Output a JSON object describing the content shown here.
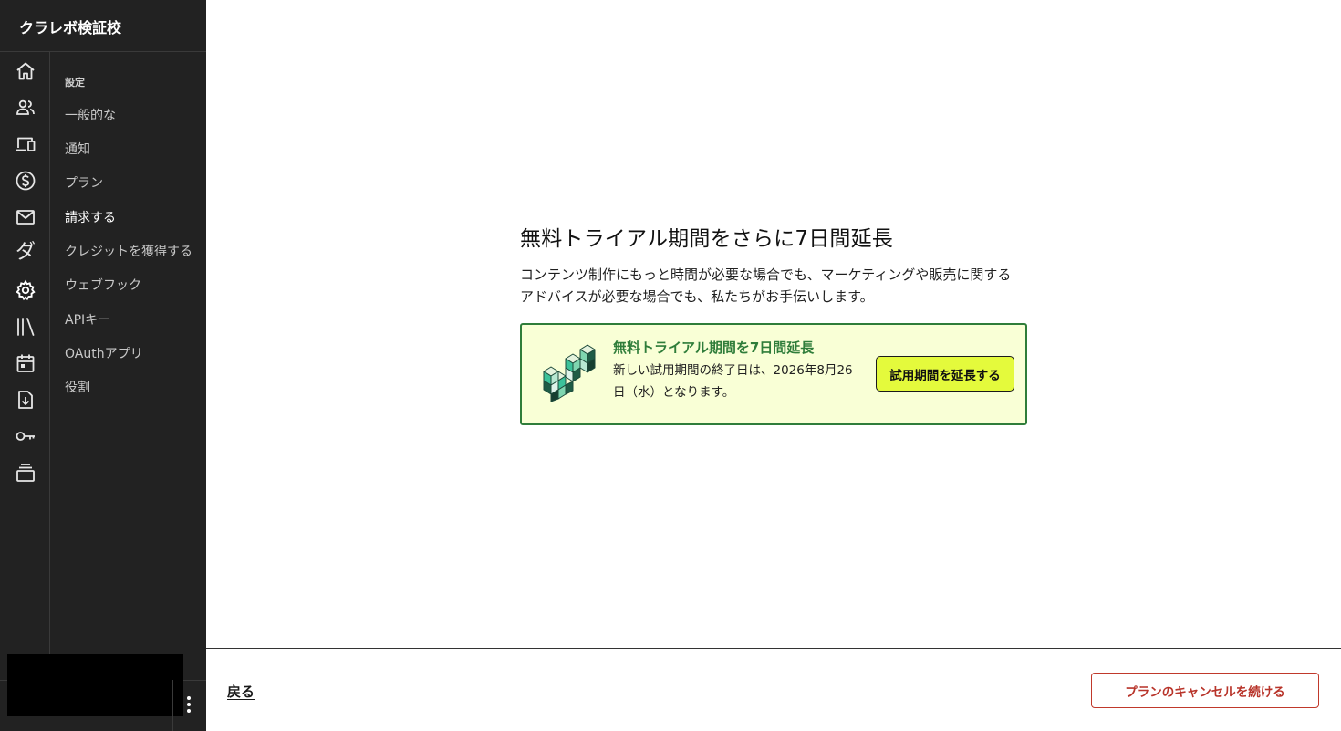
{
  "sidebar": {
    "brand": "クラレボ検証校",
    "rail_icons": [
      "home-icon",
      "people-icon",
      "devices-icon",
      "dollar-icon",
      "mail-icon",
      "da-glyph-icon",
      "gear-icon",
      "library-icon",
      "calendar-icon",
      "download-icon",
      "key-icon",
      "layers-icon"
    ],
    "da_glyph": "ダ",
    "settings_heading": "設定",
    "nav_items": [
      {
        "label": "一般的な",
        "active": false
      },
      {
        "label": "通知",
        "active": false
      },
      {
        "label": "プラン",
        "active": false
      },
      {
        "label": "請求する",
        "active": true
      },
      {
        "label": "クレジットを獲得する",
        "active": false
      },
      {
        "label": "ウェブフック",
        "active": false
      },
      {
        "label": "APIキー",
        "active": false
      },
      {
        "label": "OAuthアプリ",
        "active": false
      },
      {
        "label": "役割",
        "active": false
      }
    ]
  },
  "main": {
    "headline": "無料トライアル期間をさらに7日間延長",
    "description": "コンテンツ制作にもっと時間が必要な場合でも、マーケティングや販売に関するアドバイスが必要な場合でも、私たちがお手伝いします。",
    "offer": {
      "title": "無料トライアル期間を7日間延長",
      "text": "新しい試用期間の終了日は、2026年8月26日（水）となります。",
      "button_label": "試用期間を延長する"
    },
    "footer": {
      "back_label": "戻る",
      "cancel_label": "プランのキャンセルを続ける"
    }
  },
  "colors": {
    "sidebar_bg": "#222222",
    "offer_bg": "#f9ffd6",
    "offer_border": "#2f7d3a",
    "extend_button_bg": "#e4fa3c",
    "cancel_accent": "#c0392b"
  }
}
